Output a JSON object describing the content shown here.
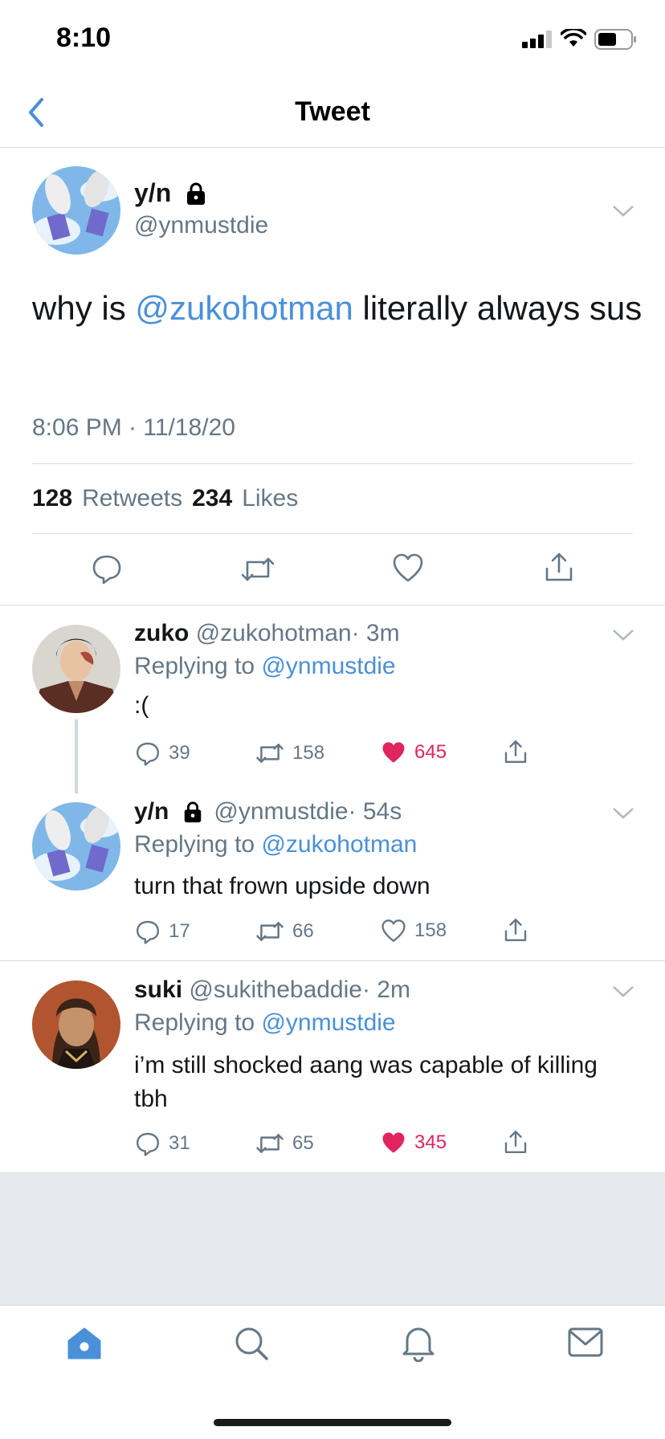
{
  "status_bar": {
    "time": "8:10"
  },
  "nav": {
    "title": "Tweet"
  },
  "main_tweet": {
    "display_name": "y/n",
    "handle": "@ynmustdie",
    "text_before": "why is ",
    "mention": "@zukohotman",
    "text_after": " literally always sus",
    "timestamp": "8:06 PM · 11/18/20",
    "retweets_count": "128",
    "retweets_label": "Retweets",
    "likes_count": "234",
    "likes_label": "Likes"
  },
  "replies": [
    {
      "name": "zuko",
      "handle": "@zukohotman",
      "time": "· 3m",
      "replying_prefix": "Replying to",
      "replying_to": "@ynmustdie",
      "text": ":(",
      "replies": "39",
      "retweets": "158",
      "likes": "645",
      "liked": true
    },
    {
      "name": "y/n",
      "handle": "@ynmustdie",
      "time": "· 54s",
      "replying_prefix": "Replying to",
      "replying_to": "@zukohotman",
      "text": "turn that frown upside down",
      "replies": "17",
      "retweets": "66",
      "likes": "158",
      "liked": false
    },
    {
      "name": "suki",
      "handle": "@sukithebaddie",
      "time": "· 2m",
      "replying_prefix": "Replying to",
      "replying_to": "@ynmustdie",
      "text": "i’m still shocked aang was capable of killing tbh",
      "replies": "31",
      "retweets": "65",
      "likes": "345",
      "liked": true
    }
  ],
  "colors": {
    "accent": "#4a90d9",
    "like": "#e0245e",
    "text_secondary": "#657786"
  },
  "tab_bar": {
    "items": [
      "home-icon",
      "search-icon",
      "notifications-icon",
      "messages-icon"
    ],
    "active": "home-icon"
  }
}
